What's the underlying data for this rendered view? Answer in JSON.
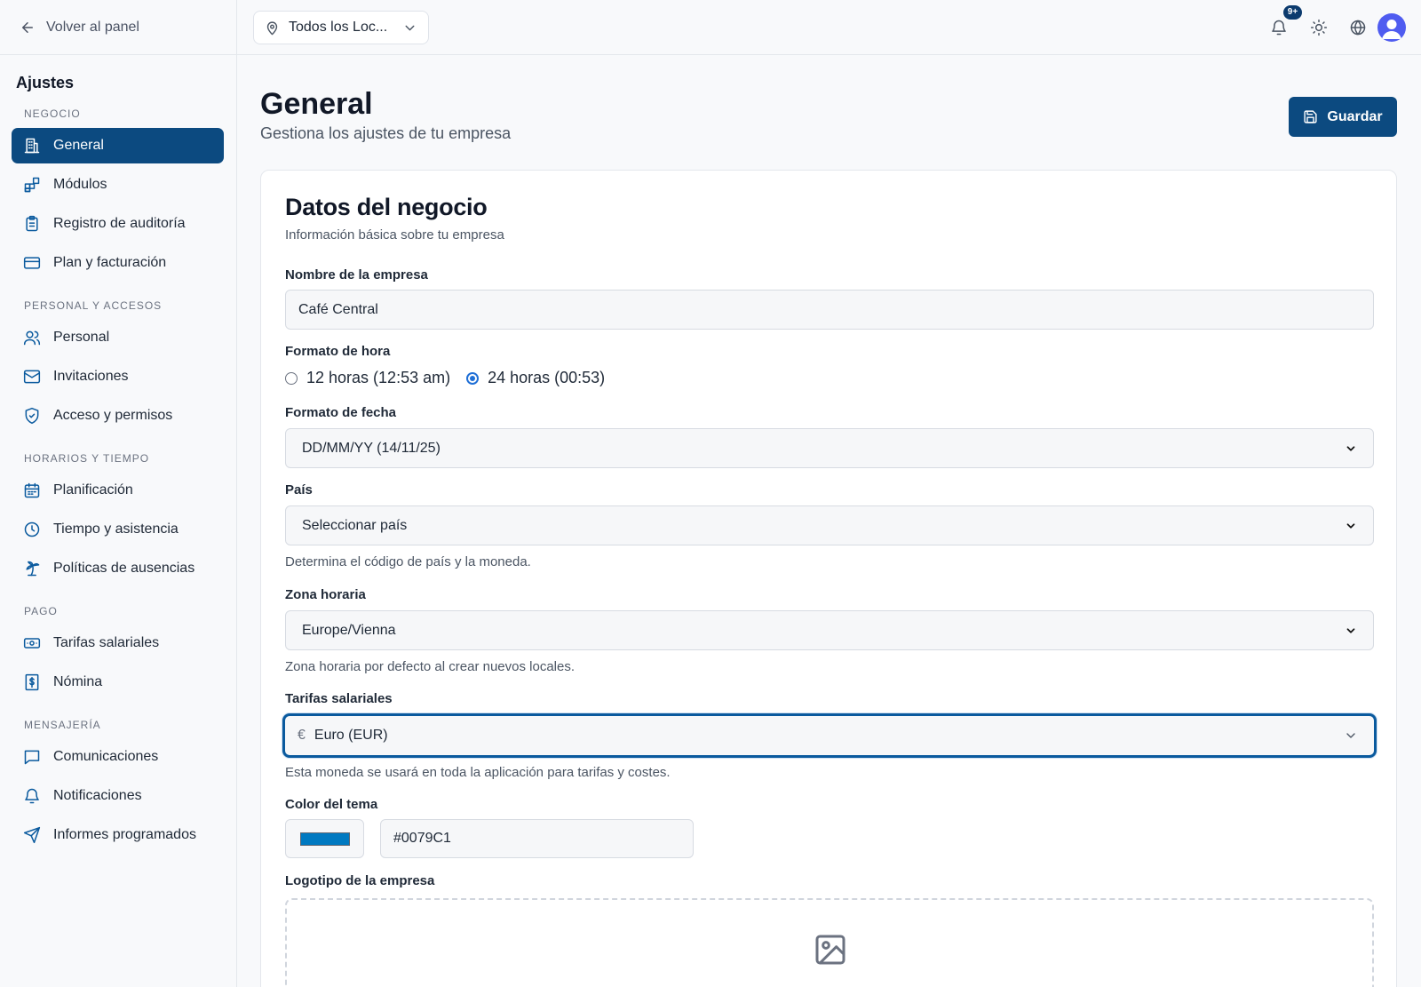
{
  "sidebar": {
    "back_label": "Volver al panel",
    "title": "Ajustes",
    "sections": {
      "negocio": {
        "label": "NEGOCIO",
        "items": [
          "General",
          "Módulos",
          "Registro de auditoría",
          "Plan y facturación"
        ]
      },
      "personal": {
        "label": "PERSONAL Y ACCESOS",
        "items": [
          "Personal",
          "Invitaciones",
          "Acceso y permisos"
        ]
      },
      "horarios": {
        "label": "HORARIOS Y TIEMPO",
        "items": [
          "Planificación",
          "Tiempo y asistencia",
          "Políticas de ausencias"
        ]
      },
      "pago": {
        "label": "PAGO",
        "items": [
          "Tarifas salariales",
          "Nómina"
        ]
      },
      "mensajeria": {
        "label": "MENSAJERÍA",
        "items": [
          "Comunicaciones",
          "Notificaciones",
          "Informes programados"
        ]
      }
    },
    "active_item": "General"
  },
  "topbar": {
    "location_label": "Todos los Loc...",
    "notification_badge": "9+"
  },
  "page": {
    "title": "General",
    "subtitle": "Gestiona los ajustes de tu empresa",
    "save_label": "Guardar"
  },
  "card": {
    "title": "Datos del negocio",
    "subtitle": "Información básica sobre tu empresa",
    "company_name": {
      "label": "Nombre de la empresa",
      "value": "Café Central"
    },
    "time_format": {
      "label": "Formato de hora",
      "options": [
        "12 horas (12:53 am)",
        "24 horas (00:53)"
      ],
      "selected": "24 horas (00:53)"
    },
    "date_format": {
      "label": "Formato de fecha",
      "value": "DD/MM/YY (14/11/25)"
    },
    "country": {
      "label": "País",
      "value": "Seleccionar país",
      "hint": "Determina el código de país y la moneda."
    },
    "timezone": {
      "label": "Zona horaria",
      "value": "Europe/Vienna",
      "hint": "Zona horaria por defecto al crear nuevos locales."
    },
    "currency": {
      "label": "Tarifas salariales",
      "symbol": "€",
      "value": "Euro (EUR)",
      "hint": "Esta moneda se usará en toda la aplicación para tarifas y costes."
    },
    "theme_color": {
      "label": "Color del tema",
      "value": "#0079C1"
    },
    "logo": {
      "label": "Logotipo de la empresa"
    }
  },
  "colors": {
    "primary": "#0c4a80",
    "theme": "#0079C1",
    "focus_ring": "#0a5a9e"
  }
}
